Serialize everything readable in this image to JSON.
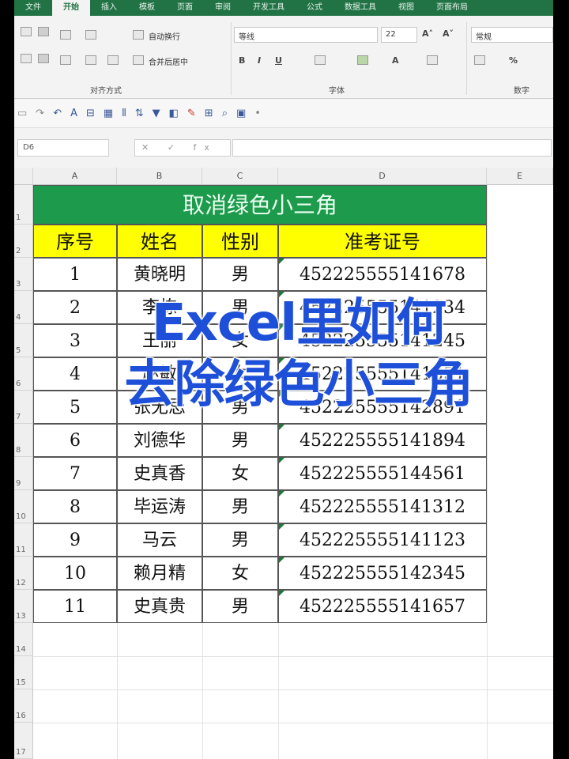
{
  "tabs": [
    "文件",
    "开始",
    "插入",
    "模板",
    "页面",
    "审阅",
    "开发工具",
    "公式",
    "数据工具",
    "视图",
    "页面布局"
  ],
  "ribbon": {
    "wrap_text": "自动换行",
    "merge_center": "合并后居中",
    "font_name": "等线",
    "font_size": "22",
    "number_format": "常规",
    "group_align": "对齐方式",
    "group_font": "字体",
    "group_number": "数字",
    "percent": "%"
  },
  "formula_bar": {
    "name_box": "D6",
    "fx": "fx",
    "value": ""
  },
  "columns": [
    "A",
    "B",
    "C",
    "D",
    "E"
  ],
  "rows": [
    "1",
    "2",
    "3",
    "4",
    "5",
    "6",
    "7",
    "8",
    "9",
    "10",
    "11",
    "12",
    "13",
    "14",
    "15",
    "16",
    "17"
  ],
  "table": {
    "title": "取消绿色小三角",
    "headers": [
      "序号",
      "姓名",
      "性别",
      "准考证号"
    ],
    "data": [
      [
        "1",
        "黄晓明",
        "男",
        "452225555141678"
      ],
      [
        "2",
        "李栋",
        "男",
        "452225555141234"
      ],
      [
        "3",
        "王丽",
        "女",
        "452225555141245"
      ],
      [
        "4",
        "赵敏",
        "女",
        "452225555141351"
      ],
      [
        "5",
        "张无忌",
        "男",
        "452225555142891"
      ],
      [
        "6",
        "刘德华",
        "男",
        "452225555141894"
      ],
      [
        "7",
        "史真香",
        "女",
        "452225555144561"
      ],
      [
        "8",
        "毕运涛",
        "男",
        "452225555141312"
      ],
      [
        "9",
        "马云",
        "男",
        "452225555141123"
      ],
      [
        "10",
        "赖月精",
        "女",
        "452225555142345"
      ],
      [
        "11",
        "史真贵",
        "男",
        "452225555141657"
      ]
    ]
  },
  "overlay": {
    "line1": "Excel里如何",
    "line2": "去除绿色小三角"
  },
  "colors": {
    "title_bg": "#1e9a4c",
    "header_bg": "#ffff00",
    "overlay_text": "#1d4fd8",
    "excel_green": "#217346"
  }
}
